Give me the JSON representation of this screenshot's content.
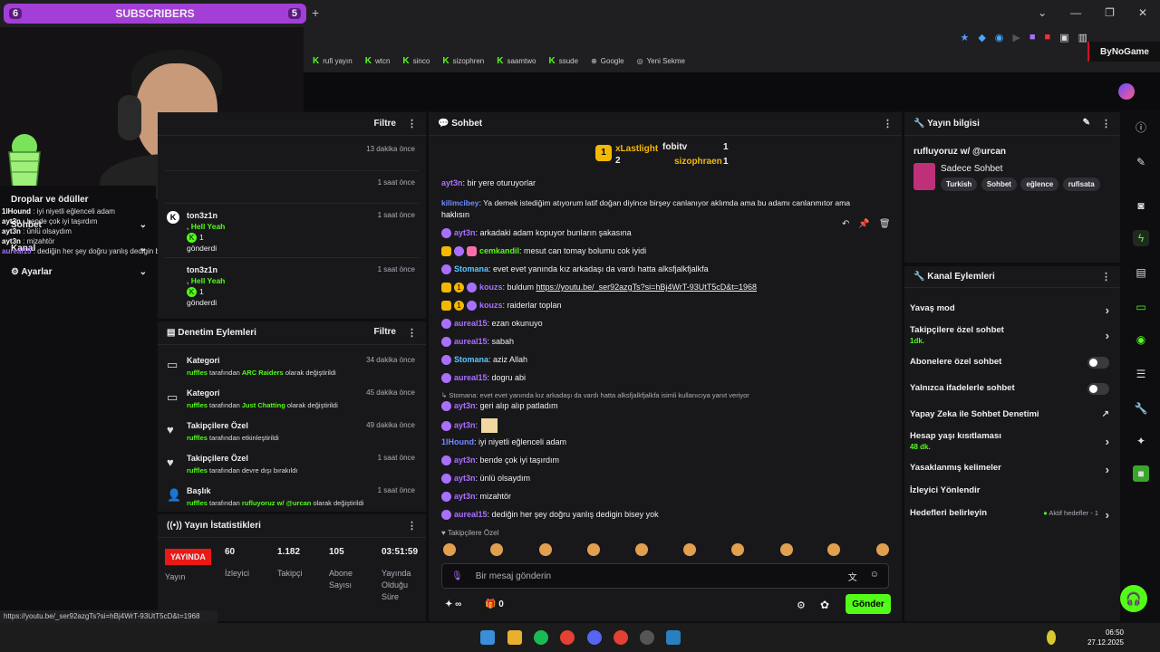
{
  "browser": {
    "tab_title": "SUBSCRIBERS",
    "tab_left_number": "6",
    "tab_right_number": "5",
    "new_tab": "+",
    "bookmarks": [
      "rufi yayın",
      "wtcn",
      "sinco",
      "sizophren",
      "saamtwo",
      "ssude",
      "Google",
      "Yeni Sekme"
    ],
    "bynogame": "ByNoGame",
    "status_url": "https://youtu.be/_ser92azgTs?si=hBj4WrT-93UtT5cD&t=1968"
  },
  "left_sidebar": {
    "items": [
      "Droplar ve ödüller",
      "Sohbet",
      "Kanal",
      "Ayarlar"
    ],
    "overlay_chat": [
      {
        "user": "1lHound",
        "text": "iyi niyetli eğlenceli adam"
      },
      {
        "user": "ayt3n",
        "text": "bende çok iyi taşırdım"
      },
      {
        "user": "ayt3n",
        "text": "ünlü olsaydım"
      },
      {
        "user": "ayt3n",
        "text": "mizahtör"
      },
      {
        "user": "aureal15",
        "text": "dediğin her şey doğru yanlış dedigin bisey yok"
      }
    ]
  },
  "activity": {
    "filter_label": "Filtre",
    "items": [
      {
        "name": "",
        "time": "13 dakika önce",
        "line1": "",
        "line2": ""
      },
      {
        "name": "",
        "time": "1 saat önce",
        "line1": "",
        "line2": ""
      },
      {
        "name": "ton3z1n",
        "time": "1 saat önce",
        "line1": ", Hell Yeah",
        "count": "1",
        "line2": "gönderdi"
      },
      {
        "name": "ton3z1n",
        "time": "1 saat önce",
        "line1": ", Hell Yeah",
        "count": "1",
        "line2": "gönderdi"
      }
    ]
  },
  "mod_actions": {
    "title": "Denetim Eylemleri",
    "filter_label": "Filtre",
    "items": [
      {
        "title": "Kategori",
        "time": "34 dakika önce",
        "user": "ruffles",
        "mid": " tarafından ",
        "hl": "ARC Raiders",
        "tail": " olarak değiştirildi"
      },
      {
        "title": "Kategori",
        "time": "45 dakika önce",
        "user": "ruffles",
        "mid": " tarafından ",
        "hl": "Just Chatting",
        "tail": " olarak değiştirildi"
      },
      {
        "title": "Takipçilere Özel",
        "time": "49 dakika önce",
        "user": "ruffles",
        "mid": " tarafından etkinleştirildi",
        "hl": "",
        "tail": ""
      },
      {
        "title": "Takipçilere Özel",
        "time": "1 saat önce",
        "user": "ruffles",
        "mid": " tarafından devre dışı bırakıldı",
        "hl": "",
        "tail": ""
      },
      {
        "title": "Başlık",
        "time": "1 saat önce",
        "user": "ruffles",
        "mid": " tarafından ",
        "hl": "rufluyoruz w/ @urcan",
        "tail": " olarak değiştirildi"
      }
    ]
  },
  "stats": {
    "title": "Yayın İstatistikleri",
    "live": "YAYINDA",
    "live_label": "Yayın",
    "viewers": "60",
    "viewers_label": "İzleyici",
    "followers": "1.182",
    "followers_label": "Takipçi",
    "subs": "105",
    "subs_label1": "Abone",
    "subs_label2": "Sayısı",
    "duration": "03:51:59",
    "duration_label1": "Yayında",
    "duration_label2": "Olduğu",
    "duration_label3": "Süre"
  },
  "chat": {
    "title": "Sohbet",
    "leaderboard": {
      "first_rank": "1",
      "first": "xLastlight",
      "first_count": "2",
      "second": "fobitv",
      "second_count": "1",
      "third": "sizophraen",
      "third_count": "1"
    },
    "messages": [
      {
        "user": "ayt3n",
        "color": "#a970ff",
        "text": ": bir yere oturuyorlar"
      },
      {
        "user": "kilimcibey",
        "color": "#6f8bff",
        "text": ": Ya demek istediğim atıyorum latif doğan diyince birşey canlanıyor aklımda ama bu adamı canlanmıtor ama"
      },
      {
        "user": "",
        "color": "#ffffff",
        "text": "haklısın"
      },
      {
        "user": "ayt3n",
        "color": "#a970ff",
        "text": ": arkadaki adam kopuyor bunların şakasına"
      },
      {
        "user": "cemkandil",
        "color": "#53fc18",
        "text": ": mesut can tomay bolumu cok iyidi"
      },
      {
        "user": "Stomana",
        "color": "#58c8ff",
        "text": ": evet evet yanında kız arkadaşı da vardı hatta alksfjalkfjalkfa"
      },
      {
        "user": "kouzs",
        "color": "#a970ff",
        "text": ": buldum ",
        "link": "https://youtu.be/_ser92azgTs?si=hBj4WrT-93UtT5cD&t=1968"
      },
      {
        "user": "kouzs",
        "color": "#a970ff",
        "text": ": raiderlar toplan"
      },
      {
        "user": "aureal15",
        "color": "#a970ff",
        "text": ": ezan okunuyo"
      },
      {
        "user": "aureal15",
        "color": "#a970ff",
        "text": ": sabah"
      },
      {
        "user": "Stomana",
        "color": "#58c8ff",
        "text": ": aziz Allah"
      },
      {
        "user": "aureal15",
        "color": "#a970ff",
        "text": ": dogru abi"
      },
      {
        "user": "",
        "color": "#adadb8",
        "text": "↳ Stomana: evet evet yanında kız arkadaşı da vardı hatta alksfjalkfjalkfa isimli kullanıcıya yanıt veriyor"
      },
      {
        "user": "ayt3n",
        "color": "#a970ff",
        "text": ": geri alıp alıp patladım"
      },
      {
        "user": "ayt3n",
        "color": "#a970ff",
        "text": ":"
      },
      {
        "user": "1lHound",
        "color": "#6f8bff",
        "text": ": iyi niyetli eğlenceli adam"
      },
      {
        "user": "ayt3n",
        "color": "#a970ff",
        "text": ": bende çok iyi taşırdım"
      },
      {
        "user": "ayt3n",
        "color": "#a970ff",
        "text": ": ünlü olsaydım"
      },
      {
        "user": "ayt3n",
        "color": "#a970ff",
        "text": ": mizahtör"
      },
      {
        "user": "aureal15",
        "color": "#a970ff",
        "text": ": dediğin her şey doğru yanlış dedigin bisey yok"
      }
    ],
    "followers_only": "Takipçilere Özel",
    "input_placeholder": "Bir mesaj gönderin",
    "points": "∞",
    "gifts": "0",
    "send": "Gönder"
  },
  "stream_info": {
    "title": "Yayın bilgisi",
    "stream_title": "rufluyoruz w/ @urcan",
    "category": "Sadece Sohbet",
    "tags": [
      "Turkish",
      "Sohbet",
      "eğlence",
      "rufisata"
    ]
  },
  "channel_actions": {
    "title": "Kanal Eylemleri",
    "rows": [
      {
        "label": "Yavaş mod",
        "sub": "",
        "type": "chevron"
      },
      {
        "label": "Takipçilere özel sohbet",
        "sub": "1dk.",
        "type": "chevron"
      },
      {
        "label": "Abonelere özel sohbet",
        "sub": "",
        "type": "toggle"
      },
      {
        "label": "Yalnızca ifadelerle sohbet",
        "sub": "",
        "type": "toggle"
      },
      {
        "label": "Yapay Zeka ile Sohbet Denetimi",
        "sub": "",
        "type": "external"
      },
      {
        "label": "Hesap yaşı kısıtlaması",
        "sub": "48 dk.",
        "type": "chevron"
      },
      {
        "label": "Yasaklanmış kelimeler",
        "sub": "",
        "type": "chevron"
      },
      {
        "label": "İzleyici Yönlendir",
        "sub": "",
        "type": "none"
      },
      {
        "label": "Hedefleri belirleyin",
        "sub": "",
        "type": "chevron",
        "status": "Aktif hedefler - 1"
      }
    ]
  },
  "clock": {
    "time": "06:50",
    "date": "27.12.2025"
  },
  "colors": {
    "accent": "#53fc18",
    "live": "#e91916",
    "tab": "#a33fd6"
  }
}
